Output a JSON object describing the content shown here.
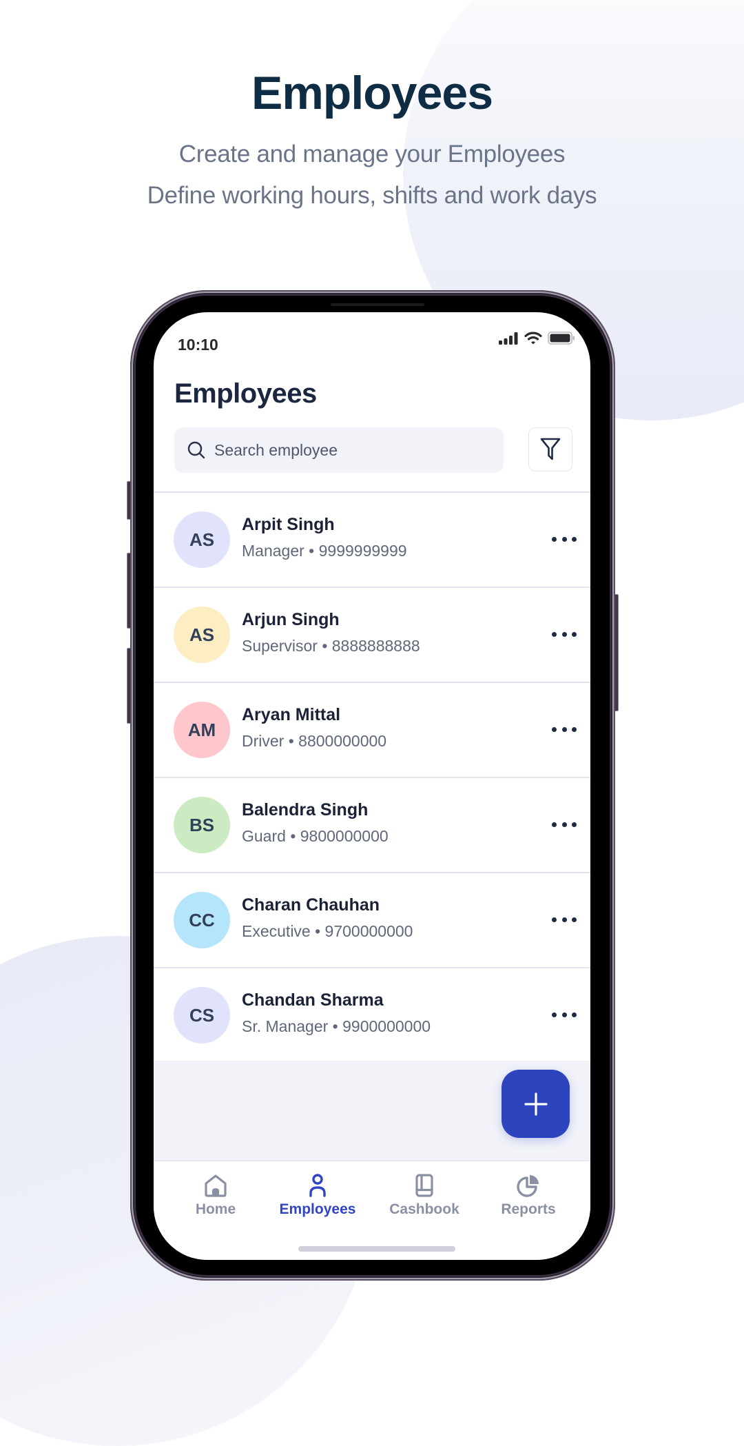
{
  "hero": {
    "title": "Employees",
    "subtitle_line1": "Create and manage your Employees",
    "subtitle_line2": "Define working hours, shifts  and work days"
  },
  "status_bar": {
    "time": "10:10",
    "icons": [
      "signal-icon",
      "wifi-icon",
      "battery-icon"
    ]
  },
  "app": {
    "title": "Employees",
    "search": {
      "placeholder": "Search employee",
      "value": ""
    },
    "filter_icon": "filter-funnel-icon"
  },
  "employees": [
    {
      "initials": "AS",
      "name": "Arpit Singh",
      "role": "Manager",
      "phone": "9999999999",
      "subtitle": "Manager • 9999999999",
      "avatar_color": "#e1e2fb"
    },
    {
      "initials": "AS",
      "name": "Arjun Singh",
      "role": "Supervisor",
      "phone": "8888888888",
      "subtitle": "Supervisor • 8888888888",
      "avatar_color": "#fdedc2"
    },
    {
      "initials": "AM",
      "name": "Aryan Mittal",
      "role": "Driver",
      "phone": "8800000000",
      "subtitle": "Driver  • 8800000000",
      "avatar_color": "#ffc7cb"
    },
    {
      "initials": "BS",
      "name": "Balendra Singh",
      "role": "Guard",
      "phone": "9800000000",
      "subtitle": "Guard • 9800000000",
      "avatar_color": "#cdebc2"
    },
    {
      "initials": "CC",
      "name": "Charan Chauhan",
      "role": "Executive",
      "phone": "9700000000",
      "subtitle": "Executive • 9700000000",
      "avatar_color": "#b5e5fa"
    },
    {
      "initials": "CS",
      "name": "Chandan Sharma",
      "role": "Sr. Manager",
      "phone": "9900000000",
      "subtitle": "Sr. Manager • 9900000000",
      "avatar_color": "#e1e2fb"
    }
  ],
  "fab": {
    "icon": "plus-icon"
  },
  "bottom_nav": {
    "items": [
      {
        "label": "Home",
        "icon": "home-icon",
        "active": false
      },
      {
        "label": "Employees",
        "icon": "person-icon",
        "active": true
      },
      {
        "label": "Cashbook",
        "icon": "book-icon",
        "active": false
      },
      {
        "label": "Reports",
        "icon": "pie-chart-icon",
        "active": false
      }
    ]
  },
  "colors": {
    "accent": "#2c45bf",
    "active_nav": "#2f45c4",
    "inactive_nav": "#8a90a3",
    "hero_title": "#0e2d45",
    "hero_subtitle": "#6a7489"
  }
}
